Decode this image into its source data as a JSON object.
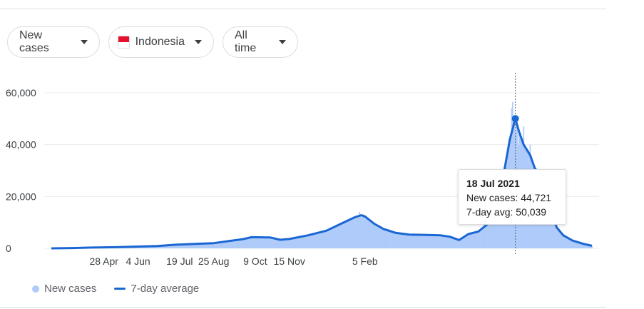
{
  "filters": {
    "metric": "New cases",
    "country": "Indonesia",
    "range": "All time"
  },
  "icons": {
    "dropdown": "caret-down-icon",
    "country_flag": "indonesia-flag-icon"
  },
  "colors": {
    "bars": "#aecbfa",
    "avg_line": "#1a66d2",
    "grid": "#ececec",
    "flag_red": "#e8112d"
  },
  "tooltip": {
    "date": "18 Jul 2021",
    "new_cases": "New cases: 44,721",
    "avg": "7-day avg: 50,039"
  },
  "legend": {
    "bars_label": "New cases",
    "line_label": "7-day average"
  },
  "chart_data": {
    "type": "bar",
    "title": "",
    "xlabel": "",
    "ylabel": "",
    "ylim": [
      0,
      60000
    ],
    "y_ticks": [
      0,
      20000,
      40000,
      60000
    ],
    "y_tick_labels": [
      "0",
      "20,000",
      "40,000",
      "60,000"
    ],
    "x_ticks": [
      "4 Jun",
      "25 Aug",
      "15 Nov",
      "5 Feb",
      "28 Apr",
      "19 Jul",
      "9 Oct"
    ],
    "x_range": [
      "2020-03-02",
      "2021-10-09"
    ],
    "grid": true,
    "legend_position": "bottom-left",
    "highlight": {
      "date": "2021-07-18",
      "new_cases": 44721,
      "avg_7day": 50039
    },
    "series": [
      {
        "name": "7-day average",
        "type": "line",
        "points": [
          [
            "2020-03-02",
            0
          ],
          [
            "2020-03-25",
            100
          ],
          [
            "2020-04-15",
            300
          ],
          [
            "2020-05-10",
            450
          ],
          [
            "2020-06-04",
            700
          ],
          [
            "2020-06-25",
            900
          ],
          [
            "2020-07-15",
            1400
          ],
          [
            "2020-08-05",
            1700
          ],
          [
            "2020-08-25",
            2000
          ],
          [
            "2020-09-10",
            2800
          ],
          [
            "2020-09-25",
            3500
          ],
          [
            "2020-10-05",
            4300
          ],
          [
            "2020-10-25",
            4200
          ],
          [
            "2020-11-05",
            3300
          ],
          [
            "2020-11-15",
            3600
          ],
          [
            "2020-12-05",
            5000
          ],
          [
            "2020-12-25",
            6800
          ],
          [
            "2021-01-10",
            9500
          ],
          [
            "2021-01-25",
            12000
          ],
          [
            "2021-02-01",
            12800
          ],
          [
            "2021-02-05",
            12300
          ],
          [
            "2021-02-15",
            9500
          ],
          [
            "2021-02-25",
            7500
          ],
          [
            "2021-03-10",
            6000
          ],
          [
            "2021-03-25",
            5300
          ],
          [
            "2021-04-10",
            5200
          ],
          [
            "2021-04-28",
            5000
          ],
          [
            "2021-05-08",
            4500
          ],
          [
            "2021-05-18",
            3200
          ],
          [
            "2021-05-28",
            5500
          ],
          [
            "2021-06-08",
            6500
          ],
          [
            "2021-06-20",
            10000
          ],
          [
            "2021-06-30",
            20000
          ],
          [
            "2021-07-06",
            30000
          ],
          [
            "2021-07-12",
            42000
          ],
          [
            "2021-07-18",
            50039
          ],
          [
            "2021-07-22",
            45000
          ],
          [
            "2021-07-27",
            40000
          ],
          [
            "2021-08-03",
            36000
          ],
          [
            "2021-08-10",
            29000
          ],
          [
            "2021-08-18",
            20500
          ],
          [
            "2021-08-25",
            14000
          ],
          [
            "2021-09-01",
            8000
          ],
          [
            "2021-09-08",
            5000
          ],
          [
            "2021-09-18",
            3000
          ],
          [
            "2021-09-30",
            1700
          ],
          [
            "2021-10-09",
            1000
          ]
        ]
      },
      {
        "name": "New cases",
        "type": "bar",
        "peaks": [
          [
            "2021-01-30",
            14000
          ],
          [
            "2021-02-03",
            13000
          ],
          [
            "2021-07-12",
            40000
          ],
          [
            "2021-07-14",
            54000
          ],
          [
            "2021-07-15",
            56500
          ],
          [
            "2021-07-18",
            44721
          ],
          [
            "2021-07-21",
            40000
          ],
          [
            "2021-07-27",
            47000
          ],
          [
            "2021-08-03",
            40000
          ],
          [
            "2021-08-10",
            31000
          ]
        ]
      }
    ]
  }
}
